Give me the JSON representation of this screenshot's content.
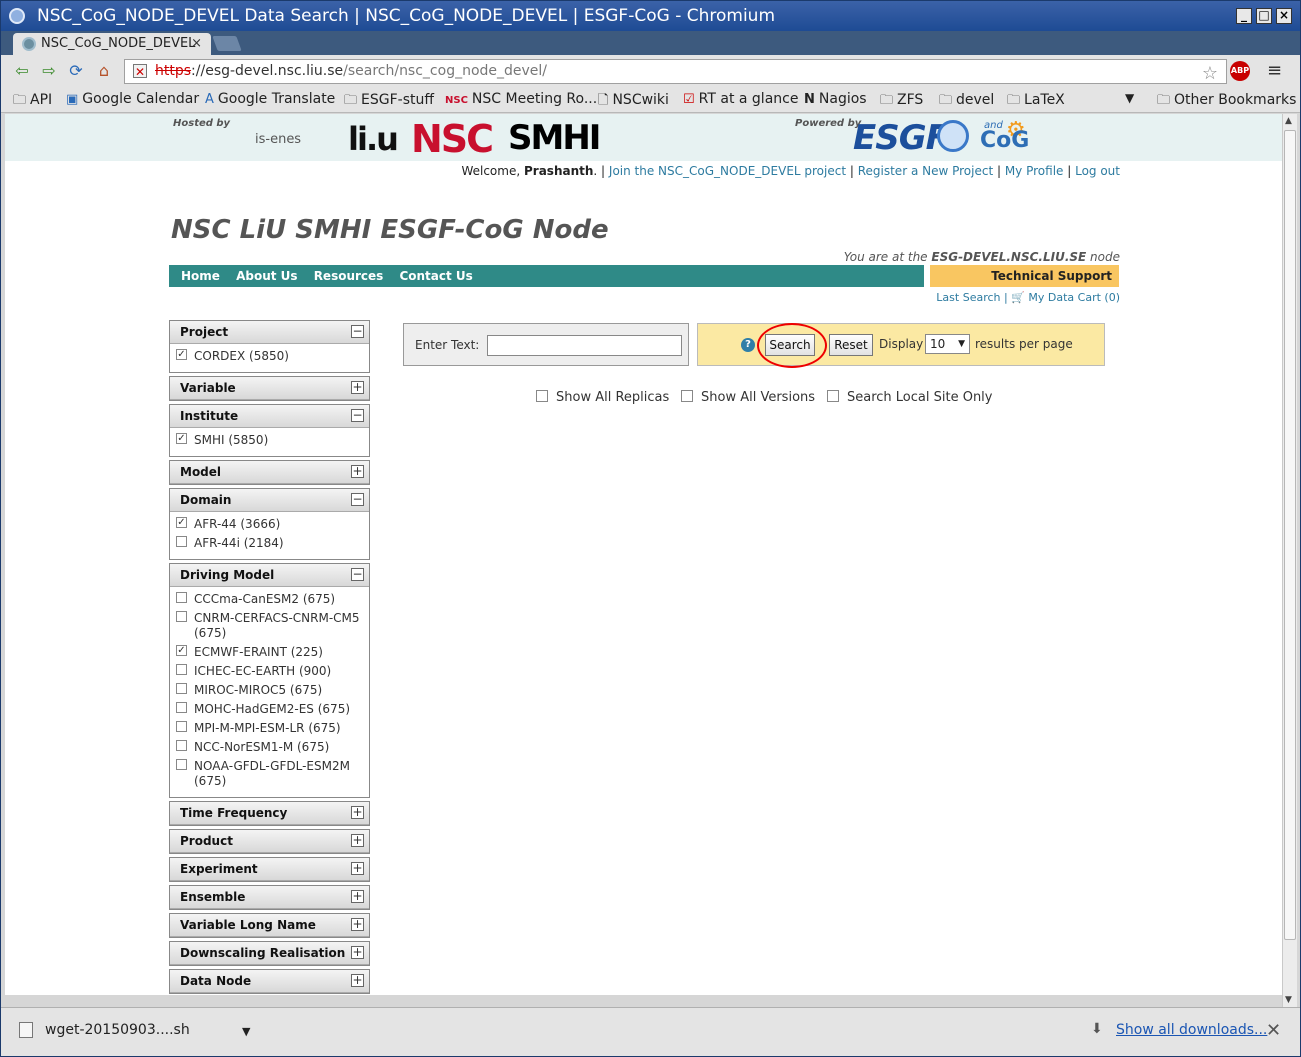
{
  "window": {
    "title": "NSC_CoG_NODE_DEVEL Data Search | NSC_CoG_NODE_DEVEL | ESGF-CoG - Chromium"
  },
  "tab": {
    "label": "NSC_CoG_NODE_DEVEL",
    "close": "×"
  },
  "url": {
    "scheme": "https",
    "sep": "://",
    "host": "esg-devel.nsc.liu.se",
    "path": "/search/nsc_cog_node_devel/"
  },
  "bookmarks": [
    {
      "label": "API",
      "icon": "folder"
    },
    {
      "label": "Google Calendar",
      "icon": "calendar"
    },
    {
      "label": "Google Translate",
      "icon": "translate"
    },
    {
      "label": "ESGF-stuff",
      "icon": "folder"
    },
    {
      "label": "NSC Meeting Ro...",
      "icon": "nsc"
    },
    {
      "label": "NSCwiki",
      "icon": "page"
    },
    {
      "label": "RT at a glance",
      "icon": "rt"
    },
    {
      "label": "Nagios",
      "icon": "nagios"
    },
    {
      "label": "ZFS",
      "icon": "folder"
    },
    {
      "label": "devel",
      "icon": "folder"
    },
    {
      "label": "LaTeX",
      "icon": "folder"
    },
    {
      "label": "Other Bookmarks",
      "icon": "folder"
    }
  ],
  "header": {
    "hosted_by": "Hosted by",
    "powered_by": "Powered by",
    "logos": {
      "isenes": "is-enes",
      "liu": "li.u",
      "nsc": "NSC",
      "smhi": "SMHI",
      "esgf": "ESGF",
      "and": "and",
      "cog": "CoG"
    }
  },
  "userbar": {
    "welcome": "Welcome,",
    "user": "Prashanth",
    "links": [
      "Join the NSC_CoG_NODE_DEVEL project",
      "Register a New Project",
      "My Profile",
      "Log out"
    ]
  },
  "site_title": "NSC LiU SMHI ESGF-CoG Node",
  "node_info": {
    "prefix": "You are at the",
    "node": "ESG-DEVEL.NSC.LIU.SE",
    "suffix": "node"
  },
  "nav": {
    "items": [
      "Home",
      "About Us",
      "Resources",
      "Contact Us"
    ],
    "support": "Technical Support"
  },
  "cart": {
    "last_search": "Last Search",
    "data_cart": "My Data Cart (0)"
  },
  "facets": [
    {
      "name": "Project",
      "expanded": true,
      "items": [
        {
          "label": "CORDEX (5850)",
          "checked": true
        }
      ]
    },
    {
      "name": "Variable",
      "expanded": false,
      "items": []
    },
    {
      "name": "Institute",
      "expanded": true,
      "items": [
        {
          "label": "SMHI (5850)",
          "checked": true
        }
      ]
    },
    {
      "name": "Model",
      "expanded": false,
      "items": []
    },
    {
      "name": "Domain",
      "expanded": true,
      "items": [
        {
          "label": "AFR-44 (3666)",
          "checked": true
        },
        {
          "label": "AFR-44i (2184)",
          "checked": false
        }
      ]
    },
    {
      "name": "Driving Model",
      "expanded": true,
      "items": [
        {
          "label": "CCCma-CanESM2 (675)",
          "checked": false
        },
        {
          "label": "CNRM-CERFACS-CNRM-CM5 (675)",
          "checked": false
        },
        {
          "label": "ECMWF-ERAINT (225)",
          "checked": true
        },
        {
          "label": "ICHEC-EC-EARTH (900)",
          "checked": false
        },
        {
          "label": "MIROC-MIROC5 (675)",
          "checked": false
        },
        {
          "label": "MOHC-HadGEM2-ES (675)",
          "checked": false
        },
        {
          "label": "MPI-M-MPI-ESM-LR (675)",
          "checked": false
        },
        {
          "label": "NCC-NorESM1-M (675)",
          "checked": false
        },
        {
          "label": "NOAA-GFDL-GFDL-ESM2M (675)",
          "checked": false
        }
      ]
    },
    {
      "name": "Time Frequency",
      "expanded": false,
      "items": []
    },
    {
      "name": "Product",
      "expanded": false,
      "items": []
    },
    {
      "name": "Experiment",
      "expanded": false,
      "items": []
    },
    {
      "name": "Ensemble",
      "expanded": false,
      "items": []
    },
    {
      "name": "Variable Long Name",
      "expanded": false,
      "items": []
    },
    {
      "name": "Downscaling Realisation",
      "expanded": false,
      "items": []
    },
    {
      "name": "Data Node",
      "expanded": false,
      "items": []
    }
  ],
  "search": {
    "enter_text_label": "Enter Text:",
    "value": "",
    "search_button": "Search",
    "reset_button": "Reset",
    "display_label": "Display",
    "per_page": "10",
    "results_label": "results per page",
    "help": "?"
  },
  "options": [
    {
      "label": "Show All Replicas",
      "checked": false
    },
    {
      "label": "Show All Versions",
      "checked": false
    },
    {
      "label": "Search Local Site Only",
      "checked": false
    }
  ],
  "download": {
    "file": "wget-20150903....sh",
    "show_all": "Show all downloads..."
  }
}
